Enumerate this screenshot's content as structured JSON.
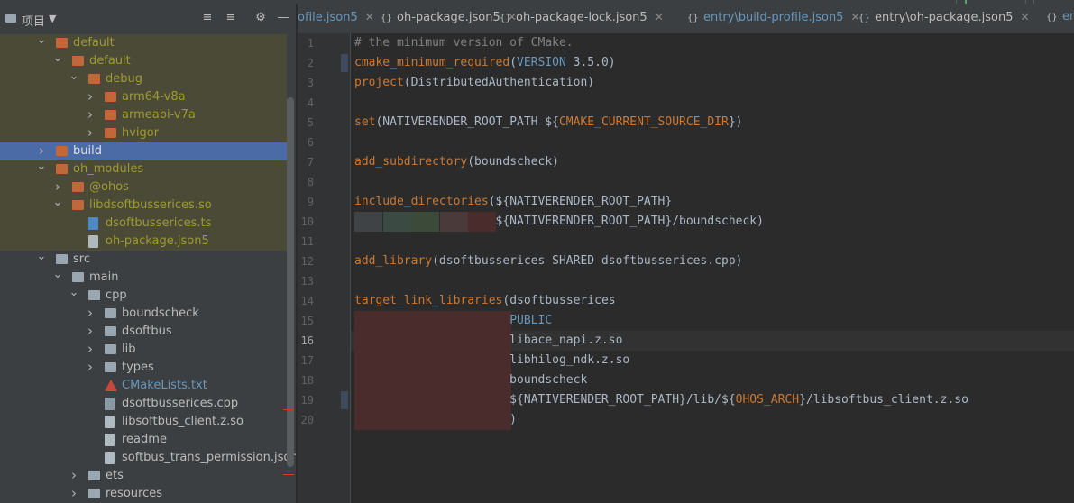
{
  "project_panel": {
    "title": "项目",
    "tree": [
      {
        "label": "default",
        "indent": 1,
        "expanded": true,
        "icon": "folder-orange",
        "color": "olive",
        "bg": "yellow"
      },
      {
        "label": "default",
        "indent": 2,
        "expanded": true,
        "icon": "folder-orange",
        "color": "olive",
        "bg": "yellow"
      },
      {
        "label": "debug",
        "indent": 3,
        "expanded": true,
        "icon": "folder-orange",
        "color": "olive",
        "bg": "yellow"
      },
      {
        "label": "arm64-v8a",
        "indent": 4,
        "expanded": false,
        "icon": "folder-orange",
        "color": "olive",
        "bg": "yellow"
      },
      {
        "label": "armeabi-v7a",
        "indent": 4,
        "expanded": false,
        "icon": "folder-orange",
        "color": "olive",
        "bg": "yellow"
      },
      {
        "label": "hvigor",
        "indent": 4,
        "expanded": false,
        "icon": "folder-orange",
        "color": "olive",
        "bg": "yellow"
      },
      {
        "label": "build",
        "indent": 1,
        "expanded": false,
        "icon": "folder-orange",
        "color": "white",
        "bg": "selected"
      },
      {
        "label": "oh_modules",
        "indent": 1,
        "expanded": true,
        "icon": "folder-orange",
        "color": "olive",
        "bg": "yellow"
      },
      {
        "label": "@ohos",
        "indent": 2,
        "expanded": false,
        "icon": "folder-orange",
        "color": "olive",
        "bg": "yellow"
      },
      {
        "label": "libdsoftbusserices.so",
        "indent": 2,
        "expanded": true,
        "icon": "folder-orange",
        "color": "olive",
        "bg": "yellow"
      },
      {
        "label": "dsoftbusserices.ts",
        "indent": 3,
        "expanded": null,
        "icon": "ts-file",
        "color": "olive",
        "bg": "yellow"
      },
      {
        "label": "oh-package.json5",
        "indent": 3,
        "expanded": null,
        "icon": "json-file",
        "color": "olive",
        "bg": "yellow"
      },
      {
        "label": "src",
        "indent": 1,
        "expanded": true,
        "icon": "folder-grey",
        "color": "normal",
        "bg": "none"
      },
      {
        "label": "main",
        "indent": 2,
        "expanded": true,
        "icon": "folder-grey",
        "color": "normal",
        "bg": "none"
      },
      {
        "label": "cpp",
        "indent": 3,
        "expanded": true,
        "icon": "folder-grey",
        "color": "normal",
        "bg": "none"
      },
      {
        "label": "boundscheck",
        "indent": 4,
        "expanded": false,
        "icon": "folder-grey",
        "color": "normal",
        "bg": "none"
      },
      {
        "label": "dsoftbus",
        "indent": 4,
        "expanded": false,
        "icon": "folder-grey",
        "color": "normal",
        "bg": "none"
      },
      {
        "label": "lib",
        "indent": 4,
        "expanded": false,
        "icon": "folder-grey",
        "color": "normal",
        "bg": "none"
      },
      {
        "label": "types",
        "indent": 4,
        "expanded": false,
        "icon": "folder-grey",
        "color": "normal",
        "bg": "none"
      },
      {
        "label": "CMakeLists.txt",
        "indent": 4,
        "expanded": null,
        "icon": "cmake-file",
        "color": "blue",
        "bg": "none"
      },
      {
        "label": "dsoftbusserices.cpp",
        "indent": 4,
        "expanded": null,
        "icon": "cpp-file",
        "color": "normal",
        "bg": "none"
      },
      {
        "label": "libsoftbus_client.z.so",
        "indent": 4,
        "expanded": null,
        "icon": "so-file",
        "color": "normal",
        "bg": "none"
      },
      {
        "label": "readme",
        "indent": 4,
        "expanded": null,
        "icon": "text-file",
        "color": "normal",
        "bg": "none"
      },
      {
        "label": "softbus_trans_permission.json",
        "indent": 4,
        "expanded": null,
        "icon": "json-file",
        "color": "normal",
        "bg": "none"
      },
      {
        "label": "ets",
        "indent": 3,
        "expanded": false,
        "icon": "folder-grey",
        "color": "normal",
        "bg": "none"
      },
      {
        "label": "resources",
        "indent": 3,
        "expanded": false,
        "icon": "folder-grey",
        "color": "normal",
        "bg": "none"
      }
    ]
  },
  "tabs": [
    {
      "label": "ofile.json5",
      "color": "blue",
      "closable": true
    },
    {
      "label": "oh-package.json5",
      "color": "normal",
      "closable": true
    },
    {
      "label": "oh-package-lock.json5",
      "color": "normal",
      "closable": true
    },
    {
      "label": "entry\\build-profile.json5",
      "color": "blue",
      "closable": true
    },
    {
      "label": "entry\\oh-package.json5",
      "color": "normal",
      "closable": true
    },
    {
      "label": "entry",
      "color": "blue",
      "closable": false
    }
  ],
  "editor": {
    "current_line": 16,
    "lines": [
      [
        {
          "t": "# the minimum version of CMake.",
          "c": "cm"
        }
      ],
      [
        {
          "t": "cmake_minimum_required",
          "c": "kw"
        },
        {
          "t": "(",
          "c": ""
        },
        {
          "t": "VERSION",
          "c": "num"
        },
        {
          "t": " 3.5.0)",
          "c": ""
        }
      ],
      [
        {
          "t": "project",
          "c": "kw"
        },
        {
          "t": "(DistributedAuthentication)",
          "c": ""
        }
      ],
      [],
      [
        {
          "t": "set",
          "c": "kw"
        },
        {
          "t": "(NATIVERENDER_ROOT_PATH ${",
          "c": ""
        },
        {
          "t": "CMAKE_CURRENT_SOURCE_DIR",
          "c": "kw"
        },
        {
          "t": "})",
          "c": ""
        }
      ],
      [],
      [
        {
          "t": "add_subdirectory",
          "c": "kw"
        },
        {
          "t": "(boundscheck)",
          "c": ""
        }
      ],
      [],
      [
        {
          "t": "include_directories",
          "c": "kw"
        },
        {
          "t": "(${NATIVERENDER_ROOT_PATH}",
          "c": ""
        }
      ],
      [
        {
          "t": "                    ${NATIVERENDER_ROOT_PATH}/boundscheck)",
          "c": ""
        }
      ],
      [],
      [
        {
          "t": "add_library",
          "c": "kw"
        },
        {
          "t": "(dsoftbusserices SHARED dsoftbusserices.cpp)",
          "c": ""
        }
      ],
      [],
      [
        {
          "t": "target_link_libraries",
          "c": "kw"
        },
        {
          "t": "(dsoftbusserices",
          "c": ""
        }
      ],
      [
        {
          "t": "                      ",
          "c": ""
        },
        {
          "t": "PUBLIC",
          "c": "num"
        }
      ],
      [
        {
          "t": "                      libace_napi.z.so",
          "c": ""
        }
      ],
      [
        {
          "t": "                      libhilog_ndk.z.so",
          "c": ""
        }
      ],
      [
        {
          "t": "                      boundscheck",
          "c": ""
        }
      ],
      [
        {
          "t": "                      ${NATIVERENDER_ROOT_PATH}/lib/${",
          "c": ""
        },
        {
          "t": "OHOS_ARCH",
          "c": "kw"
        },
        {
          "t": "}/libsoftbus_client.z.so",
          "c": ""
        }
      ],
      [
        {
          "t": "                      )",
          "c": ""
        }
      ]
    ]
  }
}
